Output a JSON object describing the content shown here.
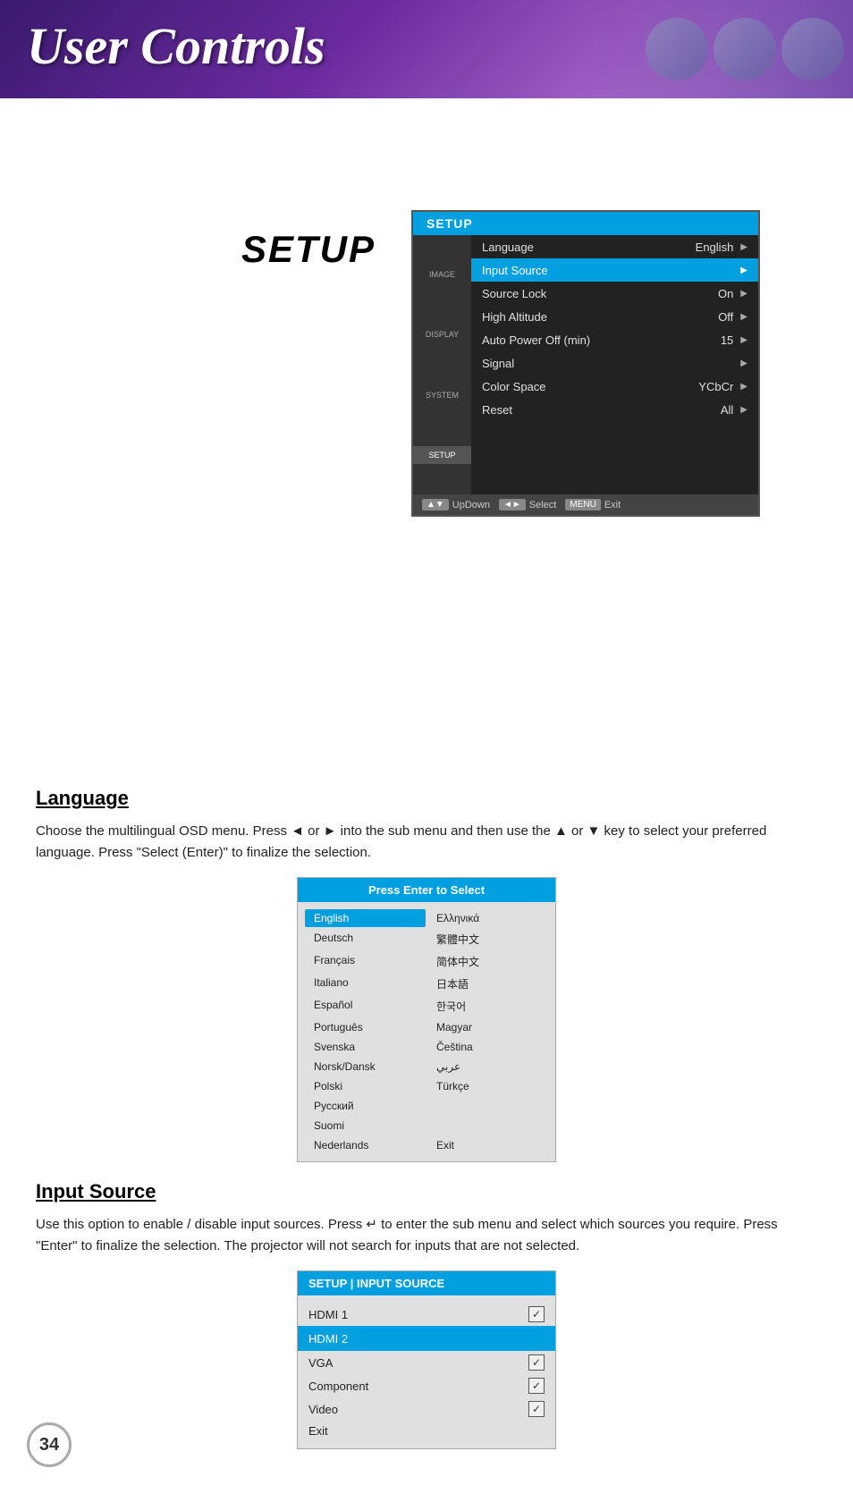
{
  "header": {
    "title": "User Controls"
  },
  "osd": {
    "title": "SETUP",
    "nav_items": [
      "IMAGE",
      "DISPLAY",
      "SYSTEM",
      "SETUP"
    ],
    "rows": [
      {
        "label": "Language",
        "value": "English",
        "highlighted": false
      },
      {
        "label": "Input Source",
        "value": "",
        "highlighted": true
      },
      {
        "label": "Source Lock",
        "value": "On",
        "highlighted": false
      },
      {
        "label": "High Altitude",
        "value": "Off",
        "highlighted": false
      },
      {
        "label": "Auto Power Off (min)",
        "value": "15",
        "highlighted": false
      },
      {
        "label": "Signal",
        "value": "",
        "highlighted": false
      },
      {
        "label": "Color Space",
        "value": "YCbCr",
        "highlighted": false
      },
      {
        "label": "Reset",
        "value": "All",
        "highlighted": false
      }
    ],
    "footer": {
      "updown_label": "UpDown",
      "lr_label": "Select",
      "menu_label": "MENU",
      "exit_label": "Exit"
    }
  },
  "setup_label": "SETUP",
  "language_section": {
    "title": "Language",
    "description": "Choose the multilingual OSD menu. Press ◄ or ► into the sub menu and then use the ▲ or ▼ key to select your preferred language. Press \"Select (Enter)\" to finalize the selection.",
    "popup": {
      "header": "Press Enter to Select",
      "languages_col1": [
        "English",
        "Deutsch",
        "Français",
        "Italiano",
        "Español",
        "Português",
        "Svenska",
        "Norsk/Dansk",
        "Polski",
        "Русский",
        "Suomi",
        "Nederlands"
      ],
      "languages_col2": [
        "Ελληνικά",
        "繁體中文",
        "简体中文",
        "日本語",
        "한국어",
        "Magyar",
        "Čeština",
        "عربي",
        "Türkçe",
        "",
        "",
        "Exit"
      ],
      "active": "English"
    }
  },
  "input_source_section": {
    "title": "Input Source",
    "description": "Use this option to enable / disable input sources. Press ↵ to enter the sub menu and select which sources you require. Press \"Enter\" to finalize the selection. The projector will not search for inputs that are not selected.",
    "popup": {
      "header": "SETUP | INPUT SOURCE",
      "rows": [
        {
          "label": "HDMI 1",
          "checked": true,
          "highlighted": false
        },
        {
          "label": "HDMI 2",
          "checked": false,
          "highlighted": true
        },
        {
          "label": "VGA",
          "checked": true,
          "highlighted": false
        },
        {
          "label": "Component",
          "checked": true,
          "highlighted": false
        },
        {
          "label": "Video",
          "checked": true,
          "highlighted": false
        },
        {
          "label": "Exit",
          "checked": false,
          "highlighted": false
        }
      ]
    }
  },
  "page_number": "34"
}
